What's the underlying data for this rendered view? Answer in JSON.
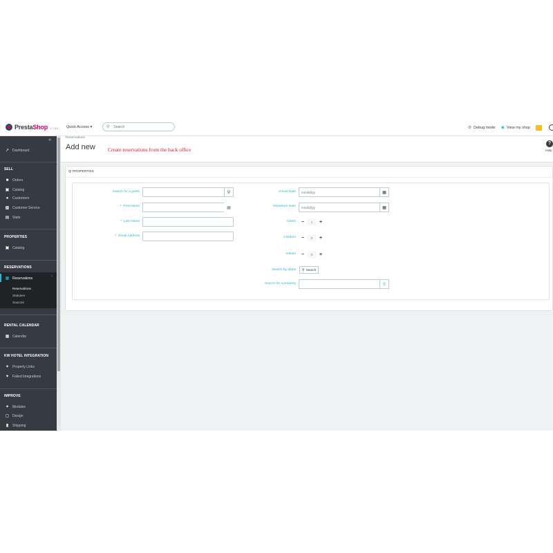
{
  "header": {
    "logo_presta": "Presta",
    "logo_shop": "Shop",
    "version": "1.7.4.2",
    "quick_access": "Quick Access ▾",
    "search_placeholder": "Search",
    "debug_mode": "Debug mode",
    "view_shop": "View my shop"
  },
  "sidebar": {
    "dashboard": "Dashboard",
    "sections": {
      "sell": "SELL",
      "properties": "PROPERTIES",
      "reservations": "RESERVATIONS",
      "rental_calendar": "RENTAL CALENDAR",
      "kw_hotel": "KW HOTEL INTEGRATION",
      "improve": "IMPROVE"
    },
    "sell_items": [
      "Orders",
      "Catalog",
      "Customers",
      "Customer Service",
      "Stats"
    ],
    "properties_items": [
      "Catalog"
    ],
    "reservations_item": "Reservations",
    "reservations_sub": [
      "Reservations",
      "Statuses",
      "Sources"
    ],
    "calendar_items": [
      "Calendar"
    ],
    "kw_items": [
      "Property Links",
      "Failed Integrations"
    ],
    "improve_items": [
      "Modules",
      "Design",
      "Shipping"
    ]
  },
  "page": {
    "breadcrumb": "Reservations",
    "title": "Add new",
    "annotation": "Create reservations from the back office",
    "help": "Help"
  },
  "panel": {
    "heading": "PROPERTIES",
    "left": {
      "search_guest": "Search for a guest",
      "first_name": "First Name",
      "last_name": "Last Name",
      "email": "Email Address"
    },
    "right": {
      "arrival_date": "Arrival Date",
      "arrival_placeholder": "mm/dd/yy",
      "departure_date": "Departure Date",
      "departure_placeholder": "mm/dd/yy",
      "adults": "Adults",
      "adults_value": "1",
      "children": "Children",
      "children_value": "0",
      "infants": "Infants",
      "infants_value": "0",
      "search_by_dates": "Search by dates",
      "search_button": "Search",
      "search_property": "Search for a property"
    }
  }
}
